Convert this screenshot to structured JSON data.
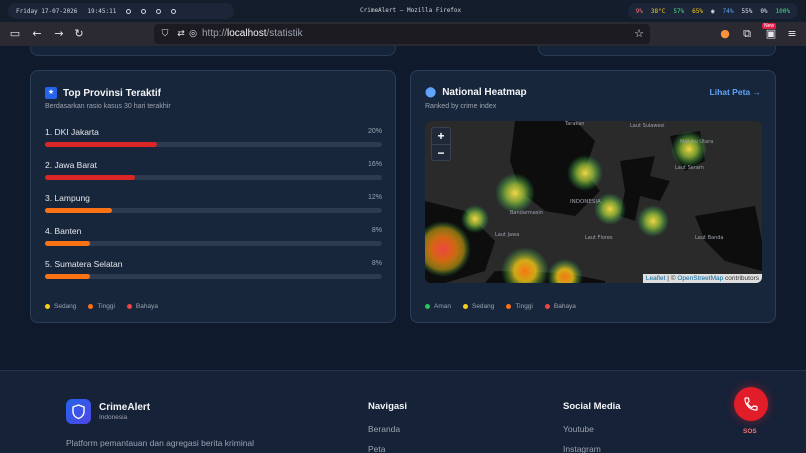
{
  "system": {
    "date": "Friday 17-07-2026",
    "time": "19:45:11",
    "window_title": "CrimeAlert — Mozilla Firefox",
    "stats": [
      {
        "label": "9%",
        "color": "#f87171"
      },
      {
        "label": "38°C",
        "color": "#facc15"
      },
      {
        "label": "57%",
        "color": "#4ade80"
      },
      {
        "label": "65%",
        "color": "#facc15"
      },
      {
        "label": "74%",
        "color": "#60a5fa"
      },
      {
        "label": "55%",
        "color": "#e5e7eb"
      },
      {
        "label": "0%",
        "color": "#e5e7eb"
      },
      {
        "label": "100%",
        "color": "#4ade80"
      }
    ]
  },
  "browser": {
    "url_prefix": "http://",
    "url_host": "localhost",
    "url_path": "/statistik",
    "new_badge": "New"
  },
  "top_provinces": {
    "title": "Top Provinsi Teraktif",
    "subtitle": "Berdasarkan rasio kasus 30 hari terakhir",
    "items": [
      {
        "name": "1. DKI Jakarta",
        "pct": "20%",
        "value": 0.2,
        "color": "#dc2626"
      },
      {
        "name": "2. Jawa Barat",
        "pct": "16%",
        "value": 0.16,
        "color": "#dc2626"
      },
      {
        "name": "3. Lampung",
        "pct": "12%",
        "value": 0.12,
        "color": "#f97316"
      },
      {
        "name": "4. Banten",
        "pct": "8%",
        "value": 0.08,
        "color": "#f97316"
      },
      {
        "name": "5. Sumatera Selatan",
        "pct": "8%",
        "value": 0.08,
        "color": "#f97316"
      }
    ],
    "legend": [
      {
        "label": "Sedang",
        "color": "#facc15"
      },
      {
        "label": "Tinggi",
        "color": "#f97316"
      },
      {
        "label": "Bahaya",
        "color": "#ef4444"
      }
    ]
  },
  "heatmap": {
    "title": "National Heatmap",
    "subtitle": "Ranked by crime index",
    "link": "Lihat Peta →",
    "zoom_in": "+",
    "zoom_out": "−",
    "attribution_leaflet": "Leaflet",
    "attribution_sep": "|  ©",
    "attribution_osm": "OpenStreetMap",
    "attribution_tail": "contributors",
    "map_labels": [
      "Tarakan",
      "Laut Sulawesi",
      "Maluku Utara",
      "INDONESIA",
      "Laut Jawa",
      "Bandarmasin",
      "Laut Banda",
      "Laut Seram",
      "Laut Flores"
    ],
    "legend": [
      {
        "label": "Aman",
        "color": "#22c55e"
      },
      {
        "label": "Sedang",
        "color": "#facc15"
      },
      {
        "label": "Tinggi",
        "color": "#f97316"
      },
      {
        "label": "Bahaya",
        "color": "#ef4444"
      }
    ]
  },
  "footer": {
    "brand": "CrimeAlert",
    "brand_sub": "Indonesia",
    "description": "Platform pemantauan dan agregasi berita kriminal lokal untuk masyarakat.",
    "nav_title": "Navigasi",
    "nav_links": [
      "Beranda",
      "Peta"
    ],
    "social_title": "Social Media",
    "social_links": [
      "Youtube",
      "Instagram"
    ],
    "sos_label": "SOS"
  }
}
